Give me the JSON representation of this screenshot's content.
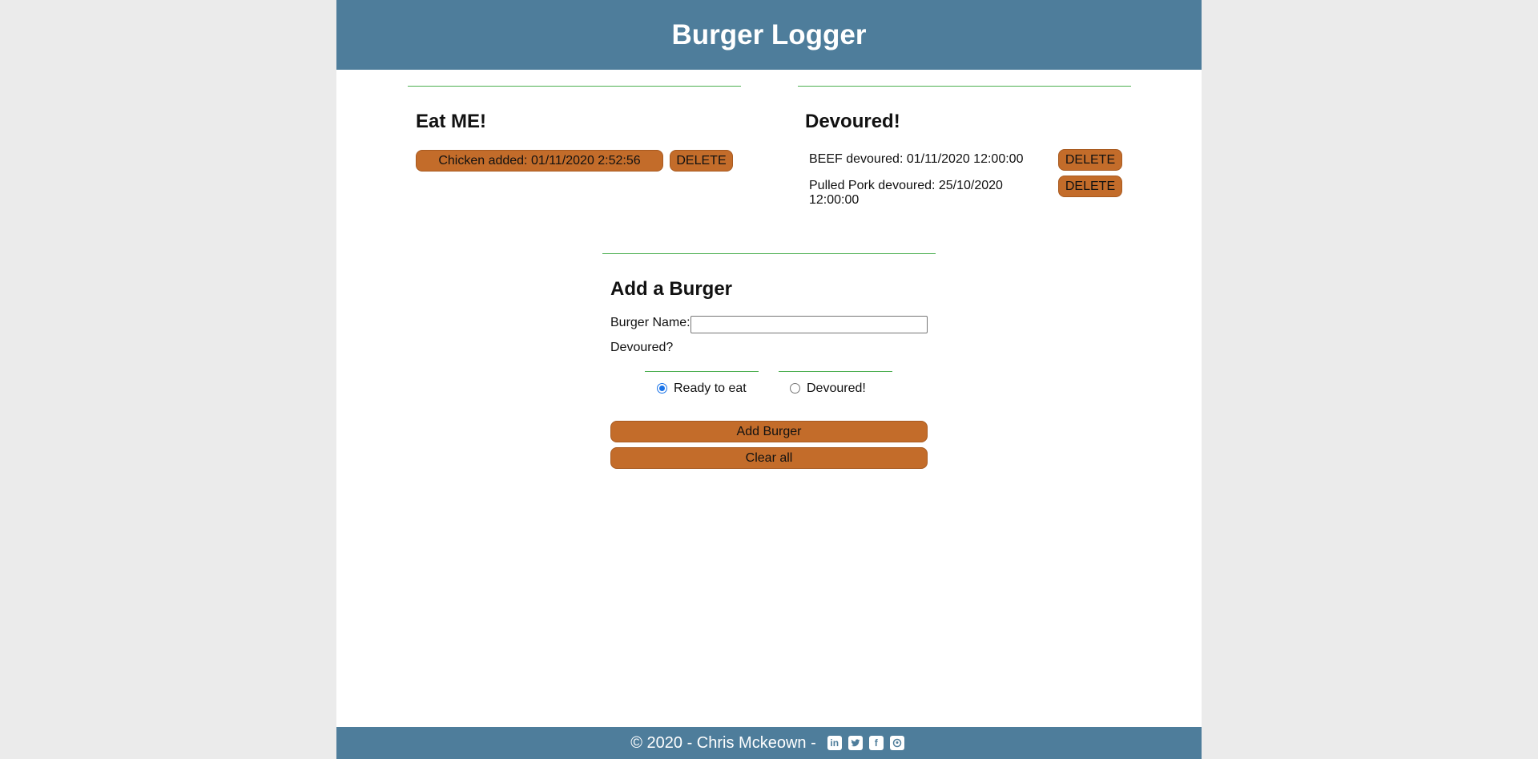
{
  "header": {
    "title": "Burger Logger"
  },
  "eat_me": {
    "title": "Eat ME!",
    "items": [
      {
        "label": "Chicken added: 01/11/2020 2:52:56",
        "delete_label": "DELETE"
      }
    ]
  },
  "devoured": {
    "title": "Devoured!",
    "items": [
      {
        "line1": "BEEF devoured: 01/11/2020 12:00:00",
        "line2": "",
        "delete_label": "DELETE"
      },
      {
        "line1": "Pulled Pork devoured: 25/10/2020",
        "line2": "12:00:00",
        "delete_label": "DELETE"
      }
    ]
  },
  "add_form": {
    "title": "Add a Burger",
    "name_label": "Burger Name:",
    "name_value": "",
    "devoured_label": "Devoured?",
    "radio_options": [
      {
        "label": "Ready to eat",
        "checked": true
      },
      {
        "label": "Devoured!",
        "checked": false
      }
    ],
    "add_button": "Add Burger",
    "clear_button": "Clear all"
  },
  "footer": {
    "text": "© 2020 - Chris Mckeown -",
    "icons": [
      "linkedin-icon",
      "twitter-icon",
      "facebook-icon",
      "github-icon"
    ]
  },
  "colors": {
    "header_bg": "#4e7d9b",
    "button_bg": "#c36c2a",
    "rule": "#4caf50",
    "page_bg": "#ebebeb"
  }
}
